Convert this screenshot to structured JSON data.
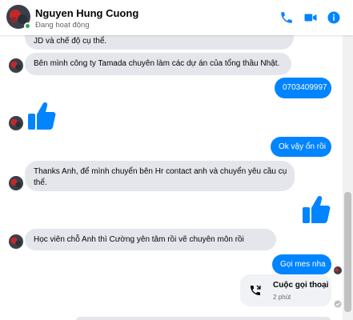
{
  "header": {
    "contact_name": "Nguyen Hung Cuong",
    "status": "Đang hoạt động"
  },
  "colors": {
    "accent": "#0084ff",
    "incoming_bubble": "#e4e6eb",
    "online": "#31a24c"
  },
  "icons": [
    "phone-icon",
    "video-camera-icon",
    "info-icon",
    "thumbs-up-icon",
    "phone-call-icon"
  ],
  "messages": {
    "m1": "JD và chế độ cụ thể.",
    "m2": "Bên mình công ty Tamada chuyên làm các dự án của tổng thầu Nhật.",
    "m3": "0703409997",
    "m5": "Ok vậy ổn rồi",
    "m6_line1": "Thanks Anh, để mình chuyển bên Hr contact anh và chuyển yêu cầu cụ",
    "m6_line2": "thể.",
    "m8": "Học viên chỗ Anh thì Cường yên tâm rồi vẽ chuyên môn rồi",
    "m9": "Gọi mes nha"
  },
  "call": {
    "title": "Cuộc gọi thoại",
    "duration": "2 phút"
  }
}
